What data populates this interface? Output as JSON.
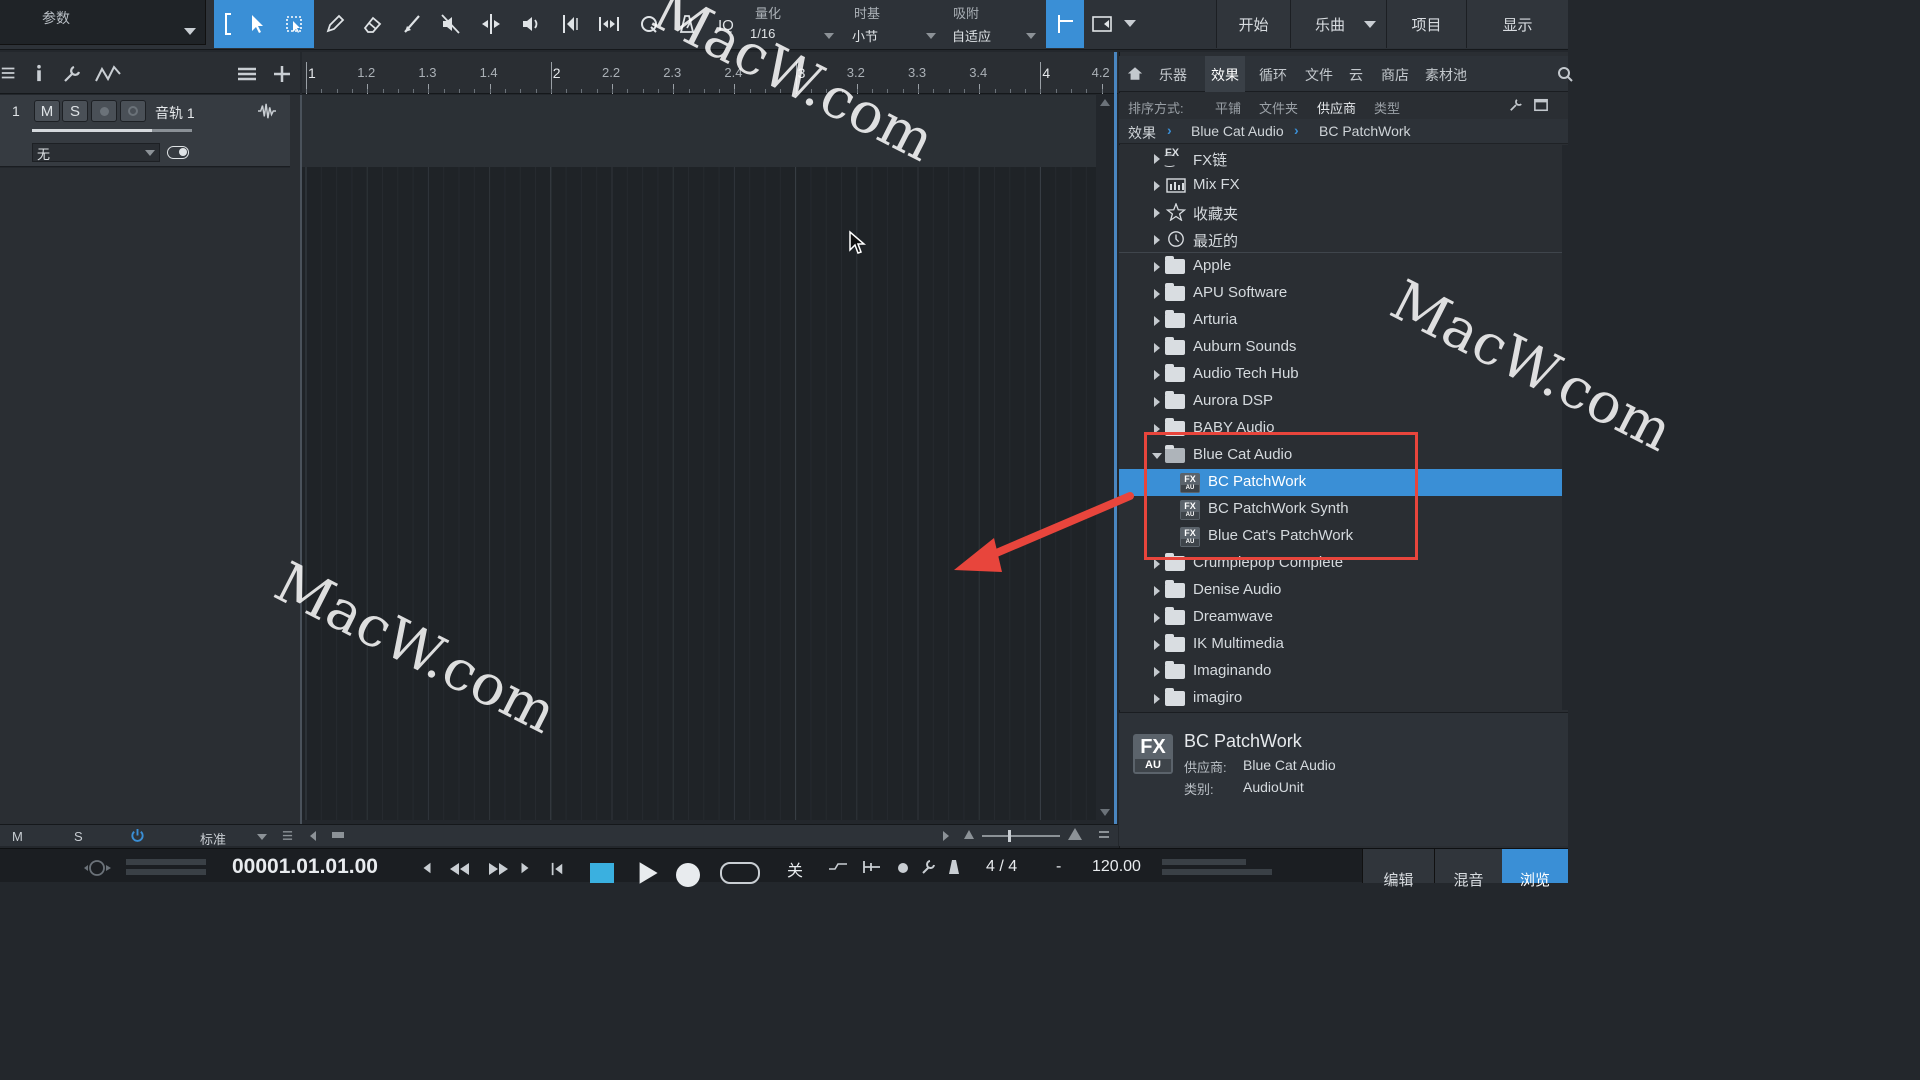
{
  "params_panel": {
    "label": "参数"
  },
  "toolbar": {
    "quantize_label": "量化",
    "quantize_value": "1/16",
    "quantize_prefix": "IQ",
    "timebase_label": "时基",
    "timebase_value": "小节",
    "snap_label": "吸附",
    "snap_value": "自适应"
  },
  "nav": {
    "start": "开始",
    "song": "乐曲",
    "project": "项目",
    "show": "显示"
  },
  "track": {
    "number": "1",
    "mute": "M",
    "solo": "S",
    "name": "音轨 1",
    "input": "无"
  },
  "ruler": {
    "marks": [
      "1",
      "1.2",
      "1.3",
      "1.4",
      "2",
      "2.2",
      "2.3",
      "2.4",
      "3",
      "3.2",
      "3.3",
      "3.4",
      "4",
      "4.2"
    ]
  },
  "bottom": {
    "m": "M",
    "s": "S",
    "mode": "标准"
  },
  "transport": {
    "time": "00001.01.01.00",
    "off": "关",
    "signature": "4 / 4",
    "dash": "-",
    "tempo": "120.00",
    "edit": "编辑",
    "mix": "混音",
    "browse": "浏览"
  },
  "browser": {
    "tabs": [
      "乐器",
      "效果",
      "循环",
      "文件",
      "云",
      "商店",
      "素材池"
    ],
    "active_tab": "效果",
    "sort_label": "排序方式:",
    "sort_options": [
      "平铺",
      "文件夹",
      "供应商",
      "类型"
    ],
    "sort_active": "供应商",
    "breadcrumb": [
      "效果",
      "Blue Cat Audio",
      "BC PatchWork"
    ],
    "items": [
      {
        "label": "FX链",
        "icon": "fx-chain-icon"
      },
      {
        "label": "Mix FX",
        "icon": "mix-fx-icon"
      },
      {
        "label": "收藏夹",
        "icon": "star-icon"
      },
      {
        "label": "最近的",
        "icon": "clock-icon"
      },
      {
        "label": "Apple",
        "icon": "folder-icon"
      },
      {
        "label": "APU Software",
        "icon": "folder-icon"
      },
      {
        "label": "Arturia",
        "icon": "folder-icon"
      },
      {
        "label": "Auburn Sounds",
        "icon": "folder-icon"
      },
      {
        "label": "Audio Tech Hub",
        "icon": "folder-icon"
      },
      {
        "label": "Aurora DSP",
        "icon": "folder-icon"
      },
      {
        "label": "BABY Audio",
        "icon": "folder-icon"
      },
      {
        "label": "Blue Cat Audio",
        "icon": "folder-open-icon"
      },
      {
        "label": "BC PatchWork",
        "icon": "fx-au-icon"
      },
      {
        "label": "BC PatchWork Synth",
        "icon": "fx-au-icon"
      },
      {
        "label": "Blue Cat's PatchWork",
        "icon": "fx-au-icon"
      },
      {
        "label": "Crumplepop Complete",
        "icon": "folder-icon"
      },
      {
        "label": "Denise Audio",
        "icon": "folder-icon"
      },
      {
        "label": "Dreamwave",
        "icon": "folder-icon"
      },
      {
        "label": "IK Multimedia",
        "icon": "folder-icon"
      },
      {
        "label": "Imaginando",
        "icon": "folder-icon"
      },
      {
        "label": "imagiro",
        "icon": "folder-icon"
      }
    ],
    "info": {
      "icon_top": "FX",
      "icon_bottom": "AU",
      "name": "BC PatchWork",
      "vendor_label": "供应商:",
      "vendor": "Blue Cat Audio",
      "category_label": "类别:",
      "category": "AudioUnit"
    }
  },
  "watermark": "MacW.com",
  "colors": {
    "accent": "#3a8fd6",
    "highlight": "#e8453c",
    "background": "#1f2327"
  }
}
